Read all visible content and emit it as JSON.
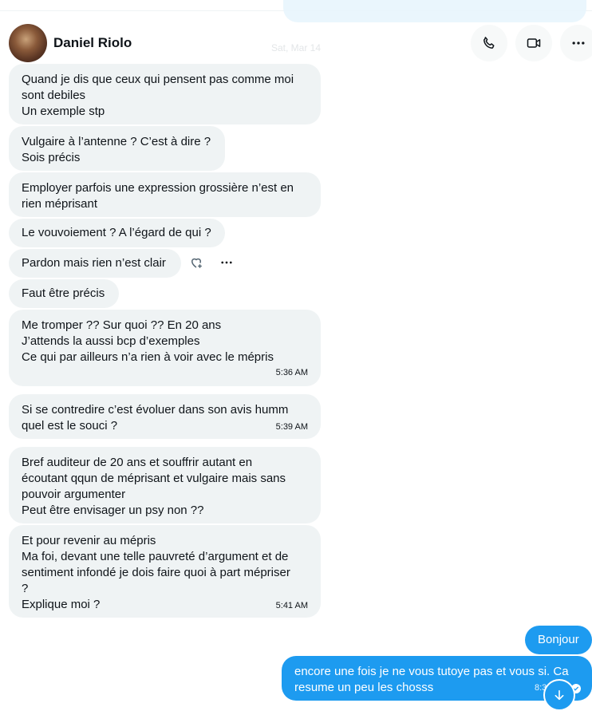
{
  "header": {
    "contact_name": "Daniel Riolo",
    "ghost_date": "Sat, Mar 14",
    "buttons": [
      "phone-icon",
      "video-icon",
      "more-icon"
    ]
  },
  "messages": [
    {
      "lines": [
        "Quand je dis que ceux qui pensent pas comme moi",
        "sont debiles",
        "Un exemple stp"
      ],
      "time": ""
    },
    {
      "lines": [
        "Vulgaire à l’antenne ? C’est à dire ?",
        "Sois précis"
      ],
      "time": ""
    },
    {
      "lines": [
        "Employer parfois une expression grossière n’est en",
        "rien méprisant"
      ],
      "time": ""
    },
    {
      "lines": [
        "Le vouvoiement ? A l’égard de qui ?"
      ],
      "time": ""
    },
    {
      "lines": [
        "Pardon mais rien n’est clair"
      ],
      "time": ""
    },
    {
      "lines": [
        "Faut être précis"
      ],
      "time": ""
    },
    {
      "lines": [
        "Me tromper ?? Sur quoi ?? En 20 ans",
        "J’attends la aussi bcp d’exemples",
        "Ce qui par ailleurs n’a rien à voir avec le mépris"
      ],
      "time": "5:36 AM"
    },
    {
      "lines": [
        "Si se contredire c’est évoluer dans son avis humm",
        "quel est le souci ?"
      ],
      "time": "5:39 AM"
    },
    {
      "lines": [
        "Bref auditeur de 20 ans et souffrir autant en",
        "écoutant qqun de méprisant et vulgaire mais sans",
        "pouvoir argumenter",
        "Peut être envisager un psy non ??"
      ],
      "time": ""
    },
    {
      "lines": [
        "Et pour revenir au mépris",
        "Ma foi, devant une telle pauvreté d’argument et de",
        "sentiment infondé je dois faire quoi à part mépriser",
        "?",
        "Explique moi ?"
      ],
      "time": "5:41 AM"
    }
  ],
  "sent": [
    {
      "lines": [
        "Bonjour"
      ]
    },
    {
      "lines": [
        "encore une fois je ne vous tutoye pas et vous si. Ca",
        "resume un peu les chosss"
      ],
      "time": "8:3"
    }
  ]
}
